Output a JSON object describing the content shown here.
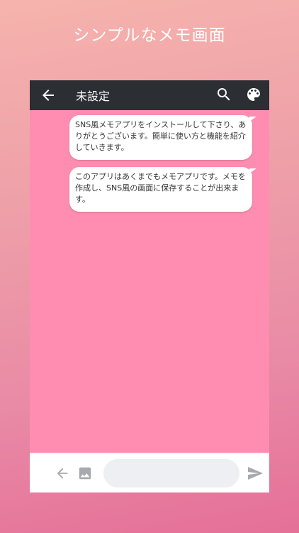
{
  "headline": "シンプルなメモ画面",
  "app_bar": {
    "title": "未設定",
    "icons": [
      "arrow-back-icon",
      "search-icon",
      "palette-icon"
    ]
  },
  "messages": [
    "SNS風メモアプリをインストールして下さり、ありがとうございます。簡単に使い方と機能を紹介していきます。",
    "このアプリはあくまでもメモアプリです。メモを作成し、SNS風の画面に保存することが出来ます。"
  ],
  "bottom_bar": {
    "input_value": "",
    "icons": [
      "arrow-back-icon",
      "image-icon",
      "send-icon"
    ]
  },
  "colors": {
    "chat_background": "#ff8db1",
    "app_bar": "#2b2e33",
    "bubble": "#ffffff"
  }
}
